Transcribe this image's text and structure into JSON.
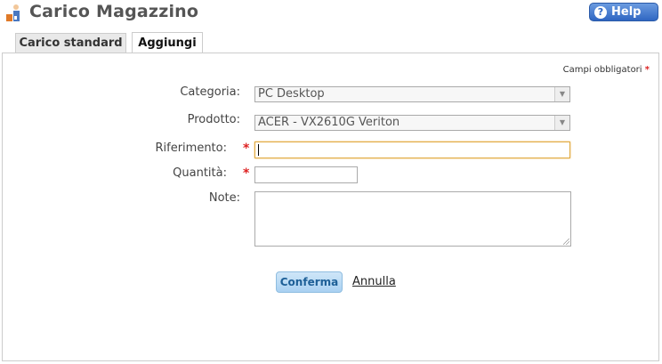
{
  "header": {
    "title": "Carico Magazzino",
    "help_label": "Help"
  },
  "tabs": [
    {
      "label": "Carico standard",
      "active": false
    },
    {
      "label": "Aggiungi",
      "active": true
    }
  ],
  "form": {
    "required_note": "Campi obbligatori",
    "categoria": {
      "label": "Categoria:",
      "value": "PC Desktop"
    },
    "prodotto": {
      "label": "Prodotto:",
      "value": "ACER - VX2610G Veriton"
    },
    "riferimento": {
      "label": "Riferimento:",
      "value": ""
    },
    "quantita": {
      "label": "Quantità:",
      "value": ""
    },
    "note": {
      "label": "Note:",
      "value": ""
    },
    "confirm_label": "Conferma",
    "cancel_label": "Annulla"
  },
  "colors": {
    "required_star": "#d22222",
    "help_button": "#2f66c2",
    "focus_border": "#e0a93d"
  }
}
